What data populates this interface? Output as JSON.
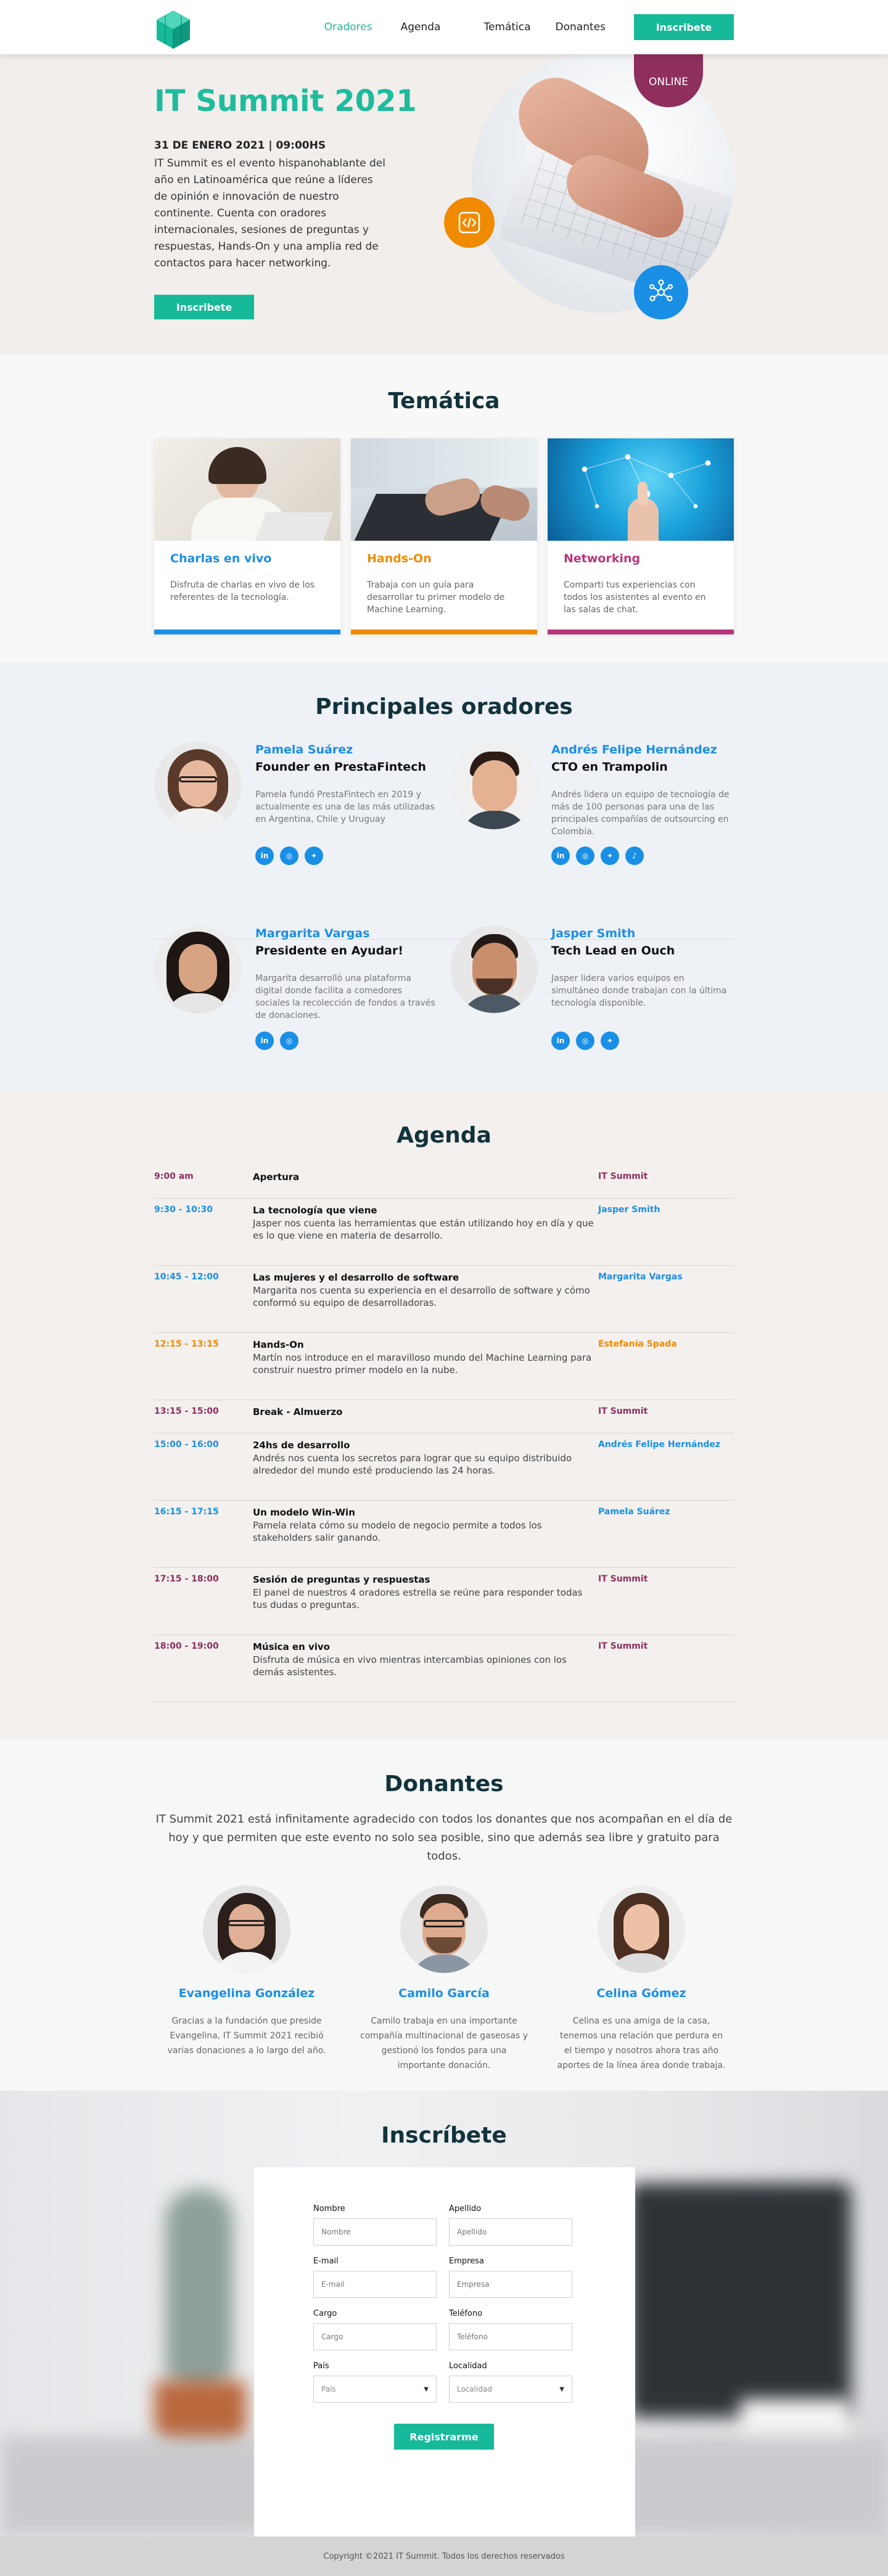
{
  "nav": {
    "links": [
      "Oradores",
      "Agenda",
      "Temática",
      "Donantes"
    ],
    "cta": "Inscribete"
  },
  "hero": {
    "title": "IT Summit 2021",
    "date": "31 DE ENERO 2021 | 09:00HS",
    "description": "IT Summit es el evento hispanohablante del año en Latinoamérica que reúne a líderes de opinión e innovación de nuestro continente. Cuenta con oradores internacionales, sesiones de preguntas y respuestas, Hands-On y una amplia red de contactos para hacer networking.",
    "cta": "Inscribete",
    "badge": "ONLINE",
    "code_icon": "code-icon",
    "network_icon": "network-icon"
  },
  "tematica": {
    "title": "Temática",
    "cards": [
      {
        "title": "Charlas en vivo",
        "text": "Disfruta de charlas en vivo de los referentes de la tecnología.",
        "color": "#1a8fe6"
      },
      {
        "title": "Hands-On",
        "text": "Trabaja con un guía para desarrollar tu primer modelo de Machine Learning.",
        "color": "#f08a00"
      },
      {
        "title": "Networking",
        "text": "Comparti tus experiencias con todos los asistentes al evento en las salas de chat.",
        "color": "#b7357a"
      }
    ]
  },
  "oradores": {
    "title": "Principales oradores",
    "speakers": [
      {
        "name": "Pamela Suárez",
        "role": "Founder en PrestaFintech",
        "bio": "Pamela fundó PrestaFintech en 2019 y actualmente es una de las más utilizadas en Argentina, Chile y Uruguay",
        "socials": [
          "in",
          "ig",
          "tw"
        ]
      },
      {
        "name": "Andrés Felipe Hernández",
        "role": "CTO en Trampolin",
        "bio": "Andrés lidera un equipo de tecnología de más de 100 personas para una de las principales compañías de outsourcing en Colombia.",
        "socials": [
          "in",
          "ig",
          "tw",
          "tk"
        ]
      },
      {
        "name": "Margarita Vargas",
        "role": "Presidente en Ayudar!",
        "bio": "Margarita desarrolló una plataforma digital donde facilita a comedores sociales la recolección de fondos a través de donaciones.",
        "socials": [
          "in",
          "ig"
        ]
      },
      {
        "name": "Jasper Smith",
        "role": "Tech Lead en Ouch",
        "bio": "Jasper lidera varios equipos en simultáneo donde trabajan con la última tecnología disponible.",
        "socials": [
          "in",
          "ig",
          "tw"
        ]
      }
    ]
  },
  "agenda": {
    "title": "Agenda",
    "items": [
      {
        "time": "9:00 am",
        "title": "Apertura",
        "desc": "",
        "speaker": "IT Summit",
        "color": "#8e2f5e"
      },
      {
        "time": "9:30 - 10:30",
        "title": "La tecnología que viene",
        "desc": "Jasper nos cuenta las herramientas que están utilizando hoy en día y que es lo que viene en materia de desarrollo.",
        "speaker": "Jasper Smith",
        "color": "#1a8fe6"
      },
      {
        "time": "10:45 - 12:00",
        "title": "Las mujeres y el desarrollo de software",
        "desc": "Margarita nos cuenta su experiencia en el desarrollo de software y cómo conformó su equipo de desarrolladoras.",
        "speaker": "Margarita Vargas",
        "color": "#1a8fe6"
      },
      {
        "time": "12:15 - 13:15",
        "title": "Hands-On",
        "desc": "Martín nos introduce en el maravilloso mundo del Machine Learning para construir nuestro primer modelo en la nube.",
        "speaker": "Estefanía Spada",
        "color": "#f08a00"
      },
      {
        "time": "13:15 - 15:00",
        "title": "Break - Almuerzo",
        "desc": "",
        "speaker": "IT Summit",
        "color": "#8e2f5e"
      },
      {
        "time": "15:00 - 16:00",
        "title": "24hs de desarrollo",
        "desc": "Andrés nos cuenta los secretos para lograr que su equipo distribuido alrededor del mundo esté produciendo las 24 horas.",
        "speaker": "Andrés Felipe Hernández",
        "color": "#1a8fe6"
      },
      {
        "time": "16:15 - 17:15",
        "title": "Un modelo Win-Win",
        "desc": "Pamela relata cómo su modelo de negocio permite a todos los stakeholders salir ganando.",
        "speaker": "Pamela Suárez",
        "color": "#1a8fe6"
      },
      {
        "time": "17:15 - 18:00",
        "title": "Sesión de preguntas y respuestas",
        "desc": "El panel de nuestros 4 oradores estrella se reúne para responder todas tus dudas o preguntas.",
        "speaker": "IT Summit",
        "color": "#8e2f5e"
      },
      {
        "time": "18:00 - 19:00",
        "title": "Música en vivo",
        "desc": "Disfruta de música en vivo mientras intercambias opiniones con los demás asistentes.",
        "speaker": "IT Summit",
        "color": "#8e2f5e"
      }
    ]
  },
  "donantes": {
    "title": "Donantes",
    "intro": "IT Summit 2021 está infinitamente agradecido con todos los donantes que nos acompañan en el día de hoy y que permiten que este evento no solo sea posible, sino que además sea libre y gratuito para todos.",
    "donors": [
      {
        "name": "Evangelina González",
        "text": "Gracias a la fundación que preside Evangelina, IT Summit 2021 recibió varias donaciones a lo largo del año."
      },
      {
        "name": "Camilo García",
        "text": "Camilo trabaja en una importante compañía multinacional de gaseosas y gestionó los fondos para una importante donación."
      },
      {
        "name": "Celina Gómez",
        "text": "Celina es una amiga de la casa, tenemos una relación que perdura en el tiempo y nosotros ahora tras año aportes de la línea área donde trabaja."
      }
    ]
  },
  "inscribete": {
    "title": "Inscríbete",
    "fields": [
      {
        "label": "Nombre",
        "placeholder": "Nombre"
      },
      {
        "label": "Apellido",
        "placeholder": "Apellido"
      },
      {
        "label": "E-mail",
        "placeholder": "E-mail"
      },
      {
        "label": "Empresa",
        "placeholder": "Empresa"
      },
      {
        "label": "Cargo",
        "placeholder": "Cargo"
      },
      {
        "label": "Teléfono",
        "placeholder": "Teléfono"
      }
    ],
    "selects": [
      {
        "label": "País",
        "value": "País"
      },
      {
        "label": "Localidad",
        "value": "Localidad"
      }
    ],
    "submit": "Registrarme"
  },
  "footer": {
    "copyright": "Copyright ©2021 IT Summit. Todos los derechos reservados"
  }
}
